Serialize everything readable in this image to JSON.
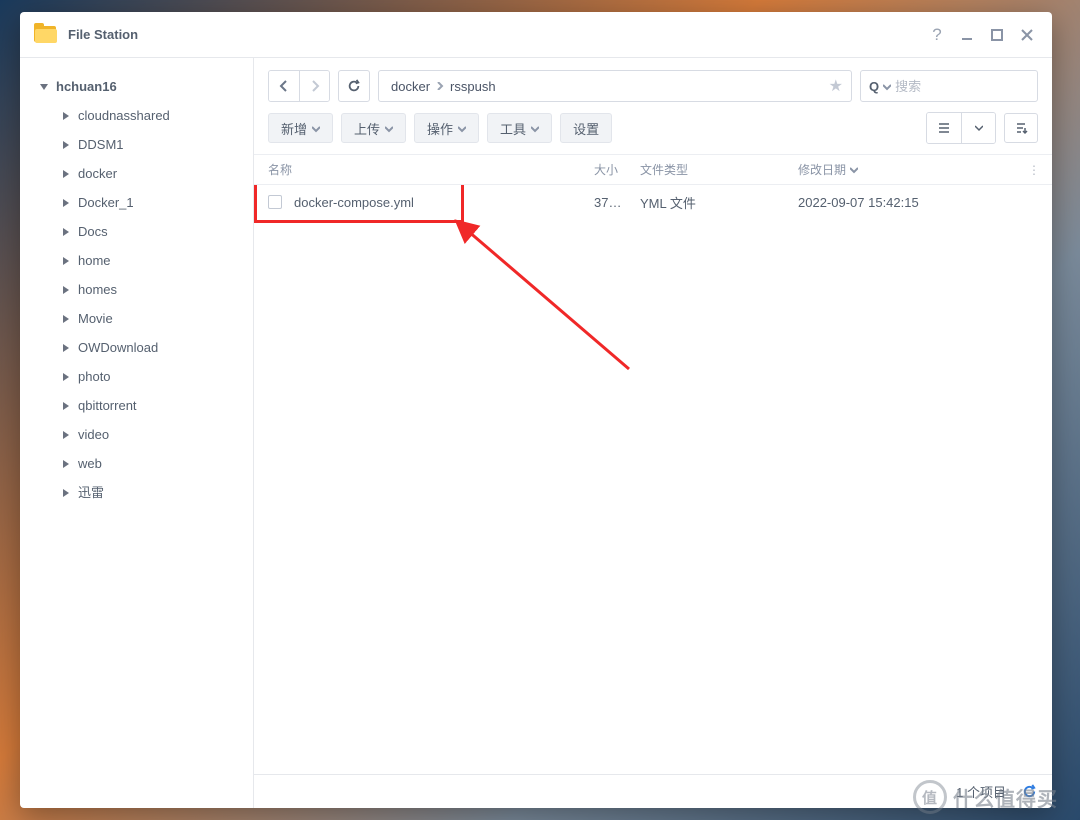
{
  "app": {
    "title": "File Station"
  },
  "window_controls": {
    "help": "?",
    "minimize": "minimize",
    "maximize": "maximize",
    "close": "close"
  },
  "sidebar": {
    "root": "hchuan16",
    "items": [
      {
        "label": "cloudnasshared"
      },
      {
        "label": "DDSM1"
      },
      {
        "label": "docker"
      },
      {
        "label": "Docker_1"
      },
      {
        "label": "Docs"
      },
      {
        "label": "home"
      },
      {
        "label": "homes"
      },
      {
        "label": "Movie"
      },
      {
        "label": "OWDownload"
      },
      {
        "label": "photo"
      },
      {
        "label": "qbittorrent"
      },
      {
        "label": "video"
      },
      {
        "label": "web"
      },
      {
        "label": "迅雷"
      }
    ]
  },
  "breadcrumb": {
    "parts": [
      "docker",
      "rsspush"
    ]
  },
  "search": {
    "prefix": "Q",
    "placeholder": "搜索"
  },
  "actions": {
    "create": "新增",
    "upload": "上传",
    "operation": "操作",
    "tools": "工具",
    "settings": "设置"
  },
  "columns": {
    "name": "名称",
    "size": "大小",
    "type": "文件类型",
    "modified": "修改日期"
  },
  "files": [
    {
      "name": "docker-compose.yml",
      "size": "37…",
      "type": "YML 文件",
      "modified": "2022-09-07 15:42:15"
    }
  ],
  "status": {
    "count_text": "1 个项目"
  },
  "watermark": {
    "badge": "值",
    "text": "什么值得买"
  }
}
